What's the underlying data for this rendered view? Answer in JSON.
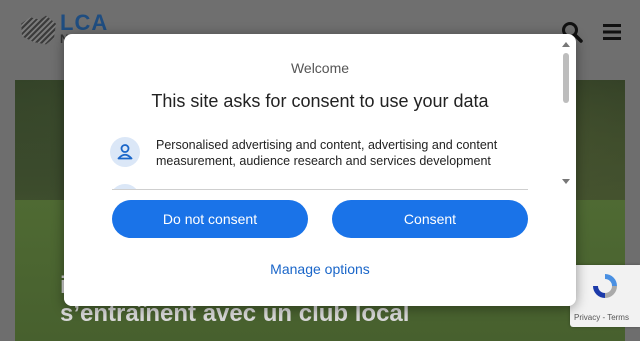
{
  "site": {
    "logo_text": "LCA",
    "logo_sub": "NEWS",
    "hero_title_line1": "i",
    "hero_title_line2": "s’entraînent avec un club local"
  },
  "consent": {
    "welcome": "Welcome",
    "heading": "This site asks for consent to use your data",
    "purpose_text": "Personalised advertising and content, advertising and content measurement, audience research and services development",
    "do_not_consent_label": "Do not consent",
    "consent_label": "Consent",
    "manage_label": "Manage options"
  },
  "recaptcha": {
    "links": "Privacy - Terms"
  },
  "colors": {
    "accent": "#1a73e8",
    "link": "#1a66c9"
  }
}
